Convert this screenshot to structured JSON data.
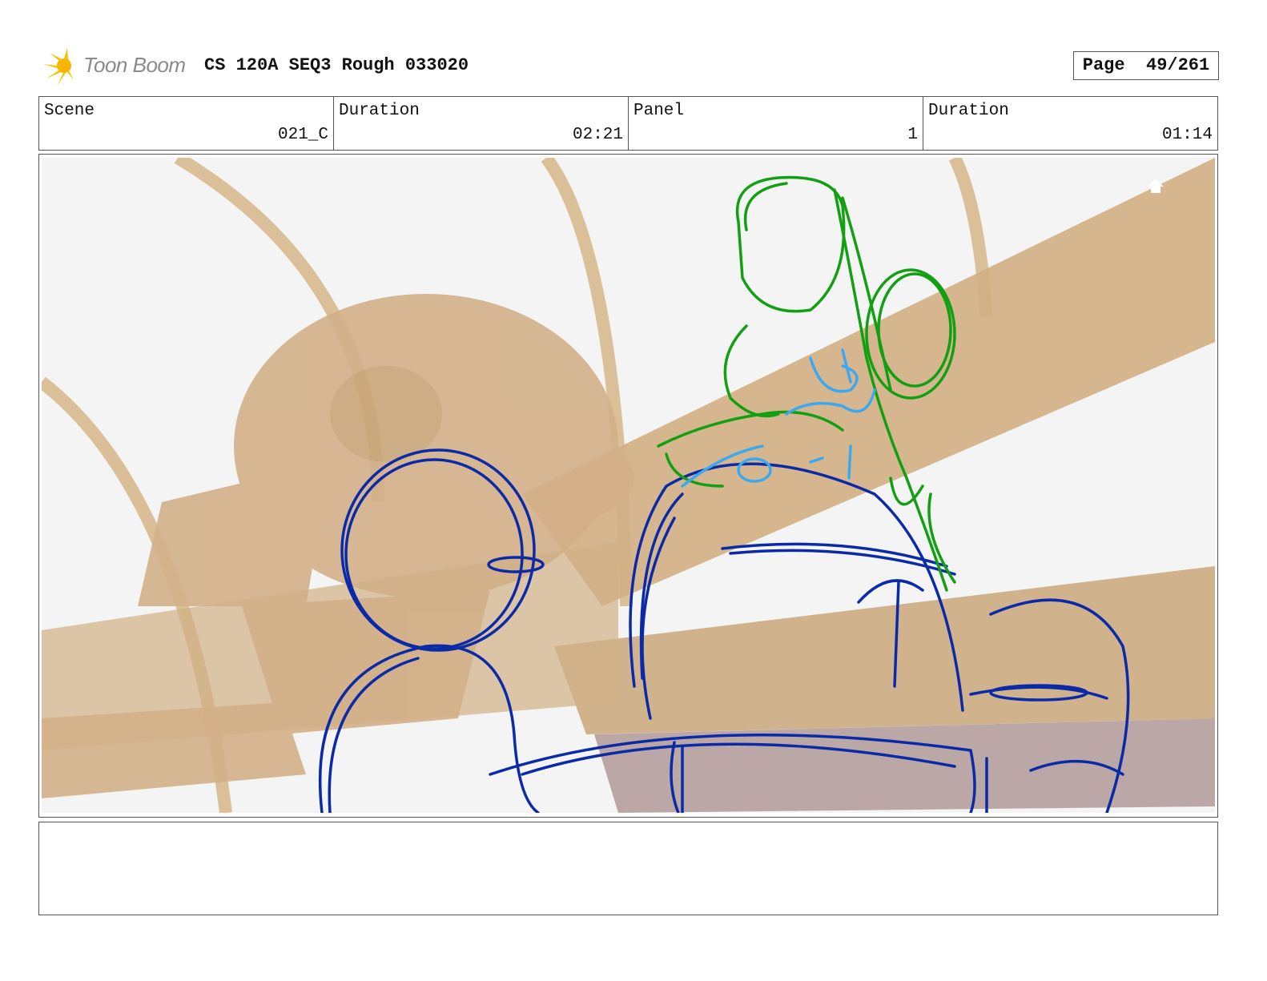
{
  "header": {
    "logo_text": "Toon Boom",
    "project_title": "CS 120A SEQ3 Rough 033020",
    "page_label": "Page",
    "page_value": "49/261"
  },
  "info": {
    "scene_label": "Scene",
    "scene_value": "021_C",
    "duration_label": "Duration",
    "duration_value": "02:21",
    "panel_label": "Panel",
    "panel_value": "1",
    "panel_duration_label": "Duration",
    "panel_duration_value": "01:14"
  },
  "notes": {
    "text": ""
  },
  "colors": {
    "sketch_blue": "#0a2aa8",
    "sketch_green": "#12a012",
    "sketch_light_blue": "#3ea8ee",
    "background_tan": "#d2b086",
    "logo_yellow": "#f5c400"
  },
  "icons": [
    "toon-boom-logo-icon",
    "home-icon"
  ]
}
